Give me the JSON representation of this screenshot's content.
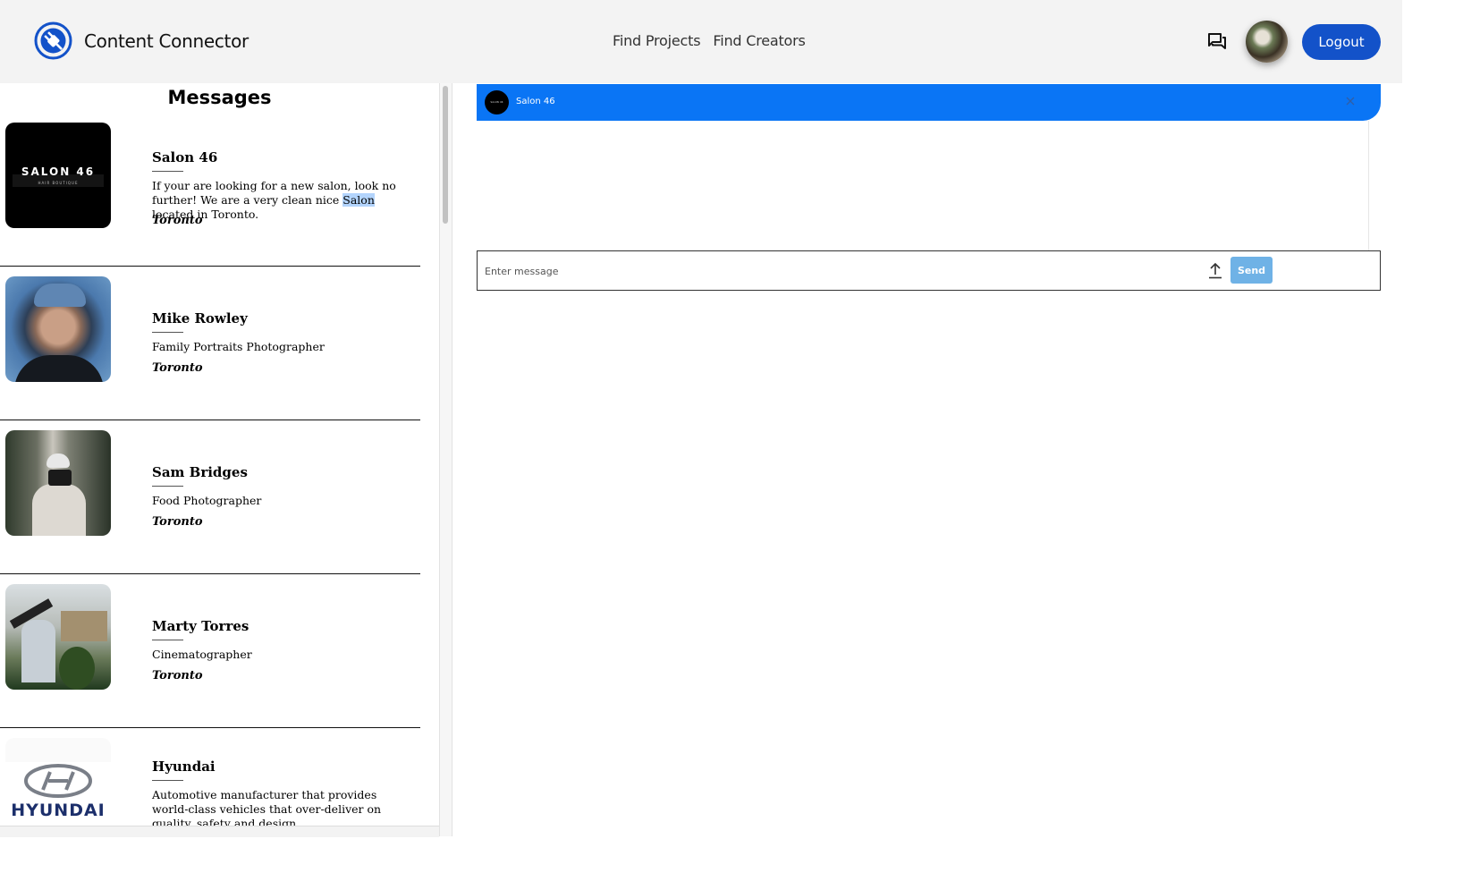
{
  "header": {
    "brand_name": "Content Connector",
    "nav": [
      {
        "label": "Find Projects"
      },
      {
        "label": "Find Creators"
      }
    ],
    "logout_label": "Logout",
    "accent_color": "#1352c9",
    "icons": [
      "plug-logo-icon",
      "chat-icon",
      "user-avatar"
    ]
  },
  "messages": {
    "title": "Messages",
    "contacts": [
      {
        "name": "Salon 46",
        "description_before": "If your are looking for a new salon, look no further! We are a very clean nice ",
        "description_highlight": "Salon",
        "description_after": " located in Toronto.",
        "city": "Toronto",
        "logo_text": "SALON 46",
        "logo_subtext": "HAIR BOUTIQUE"
      },
      {
        "name": "Mike Rowley",
        "description": "Family Portraits Photographer",
        "city": "Toronto"
      },
      {
        "name": "Sam Bridges",
        "description": "Food Photographer",
        "city": "Toronto"
      },
      {
        "name": "Marty Torres",
        "description": "Cinematographer",
        "city": "Toronto"
      },
      {
        "name": "Hyundai",
        "description": "Automotive manufacturer that provides world-class vehicles that over-deliver on quality, safety and design.",
        "logo_text": "HYUNDAI"
      }
    ]
  },
  "chat": {
    "contact_name": "Salon 46",
    "avatar_text": "SALON 46",
    "input_placeholder": "Enter message",
    "send_label": "Send",
    "header_color": "#0a75f5"
  }
}
